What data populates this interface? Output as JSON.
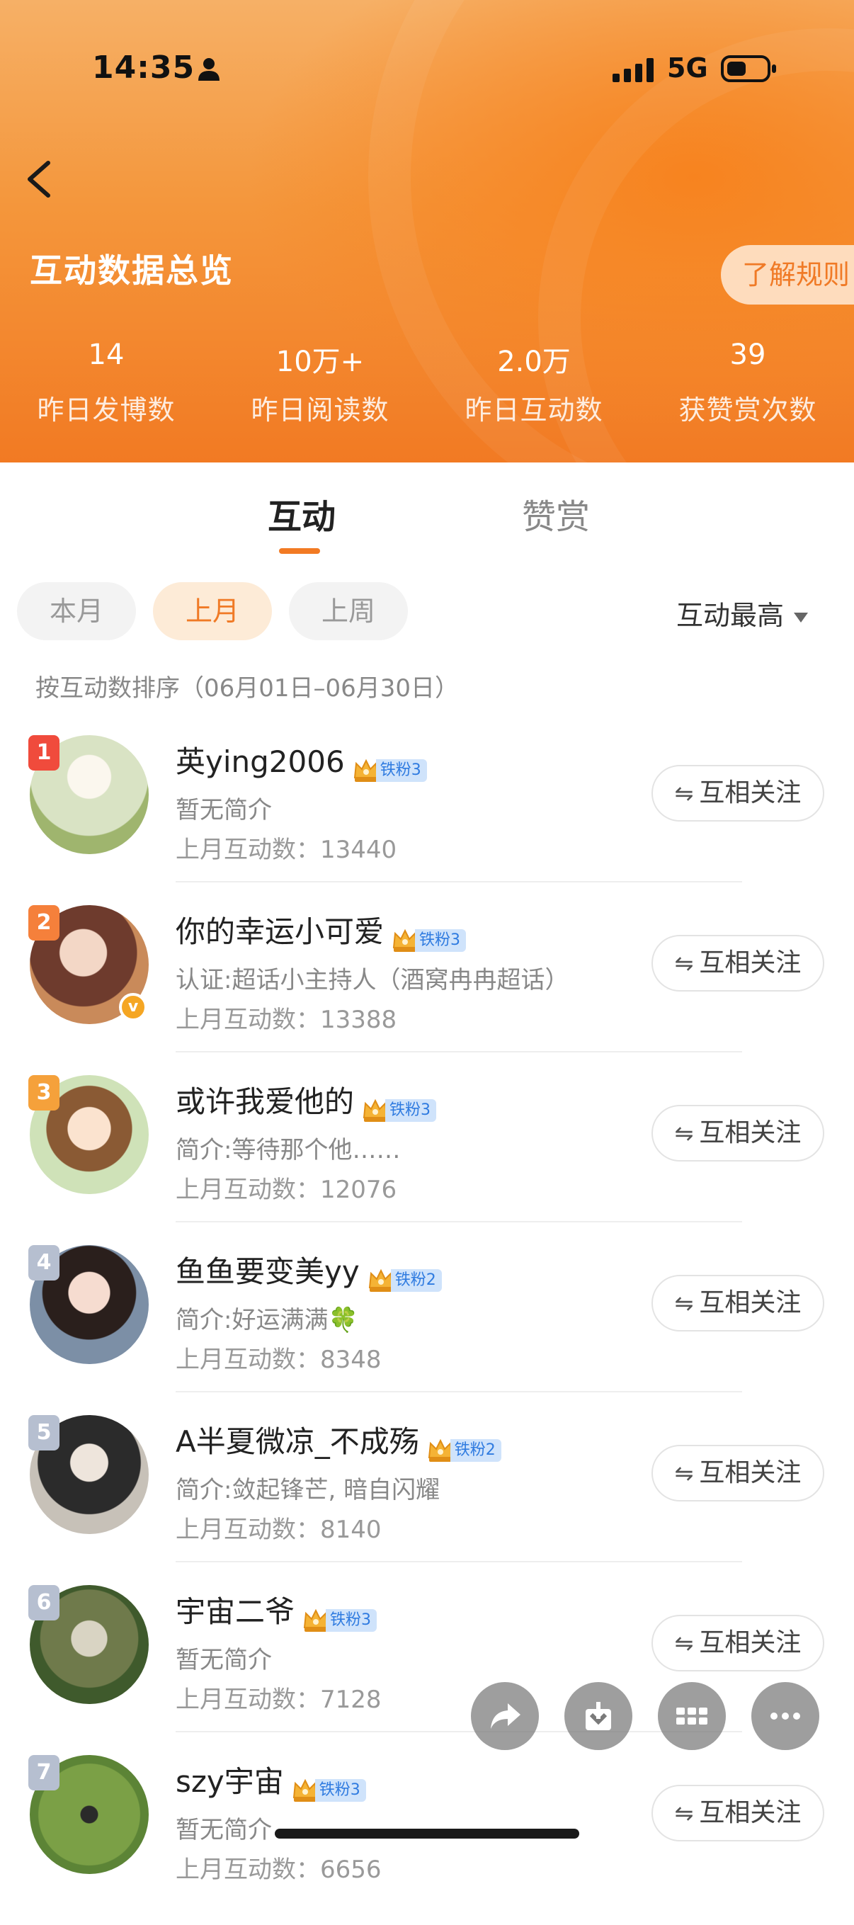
{
  "status_bar": {
    "time": "14:35",
    "network": "5G"
  },
  "header": {
    "title": "互动数据总览",
    "rules_label": "了解规则",
    "stats": [
      {
        "value": "14",
        "label": "昨日发博数"
      },
      {
        "value": "10万+",
        "label": "昨日阅读数"
      },
      {
        "value": "2.0万",
        "label": "昨日互动数"
      },
      {
        "value": "39",
        "label": "获赞赏次数"
      }
    ]
  },
  "tabs": [
    {
      "label": "互动",
      "active": true
    },
    {
      "label": "赞赏",
      "active": false
    }
  ],
  "filters": [
    {
      "label": "本月",
      "active": false
    },
    {
      "label": "上月",
      "active": true
    },
    {
      "label": "上周",
      "active": false
    }
  ],
  "sort": {
    "label": "互动最高",
    "note": "按互动数排序（06月01日–06月30日）"
  },
  "users": [
    {
      "rank": "1",
      "name": "英ying2006",
      "badge": "铁粉3",
      "desc": "暂无简介",
      "count": "上月互动数：13440",
      "follow": "互相关注",
      "rank_color": "#f04b3c"
    },
    {
      "rank": "2",
      "name": "你的幸运小可爱",
      "badge": "铁粉3",
      "desc": "认证:超话小主持人（酒窝冉冉超话）",
      "count": "上月互动数：13388",
      "follow": "互相关注",
      "rank_color": "#f5803b"
    },
    {
      "rank": "3",
      "name": "或许我爱他的",
      "badge": "铁粉3",
      "desc": "简介:等待那个他……",
      "count": "上月互动数：12076",
      "follow": "互相关注",
      "rank_color": "#f5a13b"
    },
    {
      "rank": "4",
      "name": "鱼鱼要变美yy",
      "badge": "铁粉2",
      "desc": "简介:好运满满🍀",
      "count": "上月互动数：8348",
      "follow": "互相关注",
      "rank_color": "#b6bfd0"
    },
    {
      "rank": "5",
      "name": "A半夏微凉_不成殇",
      "badge": "铁粉2",
      "desc": "简介:敛起锋芒, 暗自闪耀",
      "count": "上月互动数：8140",
      "follow": "互相关注",
      "rank_color": "#b6bfd0"
    },
    {
      "rank": "6",
      "name": "宇宙二爷",
      "badge": "铁粉3",
      "desc": "暂无简介",
      "count": "上月互动数：7128",
      "follow": "互相关注",
      "rank_color": "#b6bfd0"
    },
    {
      "rank": "7",
      "name": "szy宇宙",
      "badge": "铁粉3",
      "desc": "暂无简介",
      "count": "上月互动数：6656",
      "follow": "互相关注",
      "rank_color": "#b6bfd0"
    }
  ],
  "colors": {
    "accent": "#f27a23",
    "badge_bg": "#cfe3fb",
    "badge_text": "#2f7be0"
  },
  "floating_actions": [
    "share-icon",
    "download-icon",
    "grid-icon",
    "more-icon"
  ]
}
